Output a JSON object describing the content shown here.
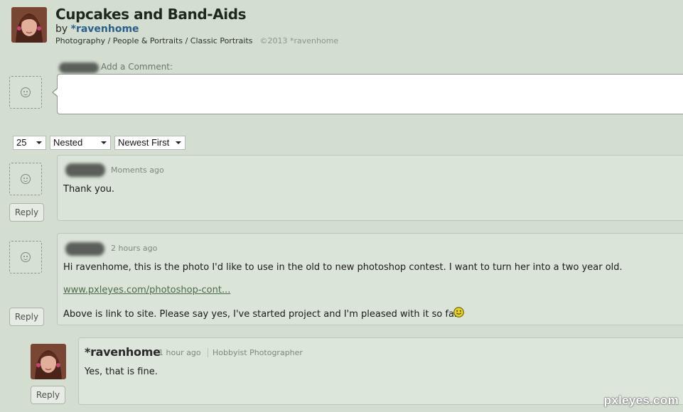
{
  "header": {
    "title": "Cupcakes and Band-Aids",
    "by_prefix": "by ",
    "author": "*ravenhome",
    "breadcrumbs": [
      "Photography",
      "People & Portraits",
      "Classic Portraits"
    ],
    "breadcrumb_separator": " / ",
    "copyright": "©2013 *ravenhome"
  },
  "add_comment": {
    "label": "Add a Comment:"
  },
  "controls": {
    "per_page": "25",
    "view_mode": "Nested",
    "sort_order": "Newest First"
  },
  "comments": [
    {
      "time": "Moments ago",
      "body": "Thank you.",
      "reply_label": "Reply"
    },
    {
      "time": "2 hours ago",
      "body": "Hi ravenhome, this is the photo I'd like to use in the old to new photoshop contest. I want to turn her into a two year old.",
      "link": "www.pxleyes.com/photoshop-cont...",
      "body2": "Above is link to site. Please say yes, I've started project and I'm pleased with it so far.",
      "reply_label": "Reply"
    },
    {
      "author": "*ravenhome",
      "time": "1 hour ago",
      "role": "Hobbyist Photographer",
      "body": "Yes, that is fine.",
      "reply_label": "Reply"
    }
  ],
  "watermark": "pxleyes.com"
}
